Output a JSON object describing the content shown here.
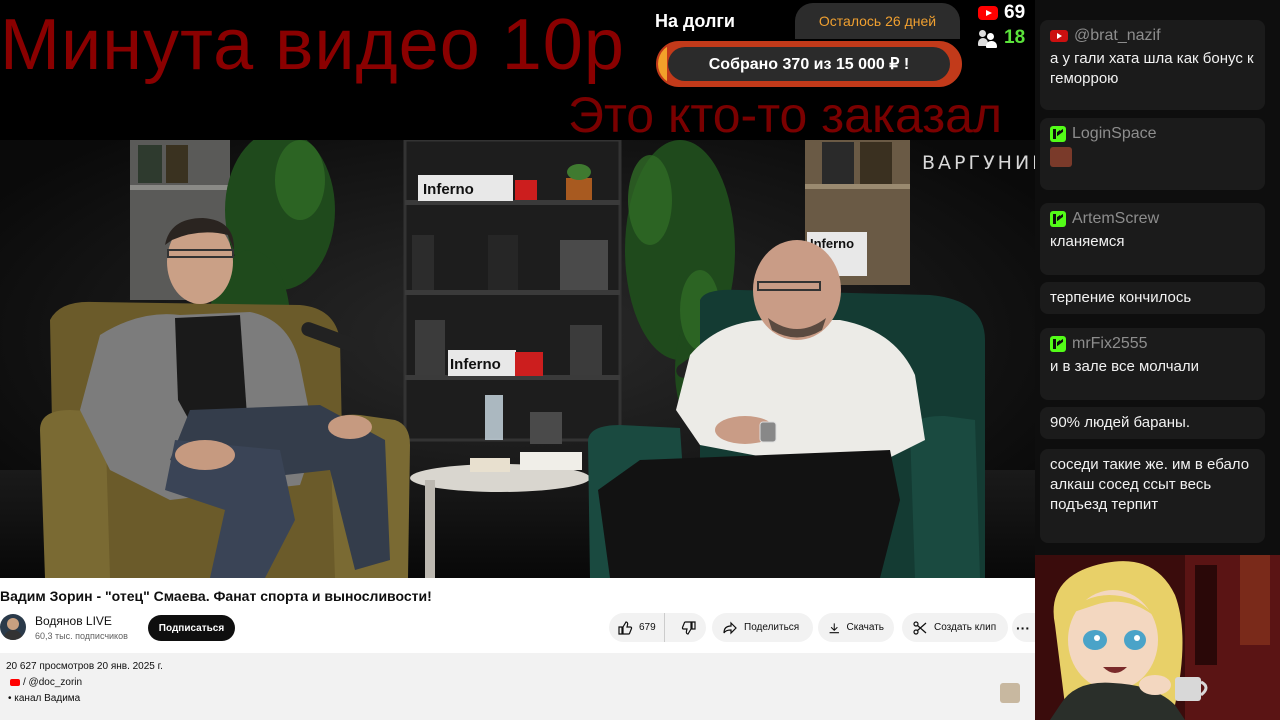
{
  "overlay": {
    "ticker_top": "Минута видео 10р",
    "ticker_bottom": "Это кто-то заказал",
    "goal_title": "На долги",
    "days_left": "Осталось 26 дней",
    "goal_text": "Собрано 370  из 15 000 ₽ !",
    "goal_progress_fraction": 0.025,
    "youtube_viewers": "69",
    "kick_viewers": "18",
    "colors": {
      "ticker": "#8a0000",
      "goal_bar": "#c23a1a",
      "goal_fill": "#f2a12a",
      "kick": "#53fc18"
    }
  },
  "video": {
    "watermark": "ВАРГУНИН",
    "shelf_label_1": "Inferno",
    "shelf_label_2": "Inferno",
    "shelf_label_3": "Inferno"
  },
  "youtube": {
    "title": "Вадим Зорин - \"отец\" Смаева. Фанат спорта и выносливости!",
    "channel_name": "Водянов LIVE",
    "subscribers": "60,3 тыс. подписчиков",
    "subscribe_label": "Подписаться",
    "likes": "679",
    "share_label": "Поделиться",
    "download_label": "Скачать",
    "clip_label": "Создать клип",
    "more_label": "···",
    "views_date": "20 627 просмотров  20 янв. 2025 г.",
    "handle": "/ @doc_zorin",
    "channel_line": "• канал Вадима"
  },
  "chat": {
    "messages": [
      {
        "platform": "youtube",
        "user": "@brat_nazif",
        "text": "а у гали хата шла как бонус к геморрою"
      },
      {
        "platform": "kick",
        "user": "LoginSpace",
        "text": "",
        "emote": true
      },
      {
        "platform": "kick",
        "user": "ArtemScrew",
        "text": "кланяемся"
      },
      {
        "platform": "none",
        "user": "",
        "text": "терпение кончилось"
      },
      {
        "platform": "kick",
        "user": "mrFix2555",
        "text": "и в зале все молчали"
      },
      {
        "platform": "none",
        "user": "",
        "text": "90% людей бараны."
      },
      {
        "platform": "none",
        "user": "",
        "text": "соседи такие же. им в ебало алкаш сосед ссыт весь подъезд терпит"
      }
    ]
  }
}
